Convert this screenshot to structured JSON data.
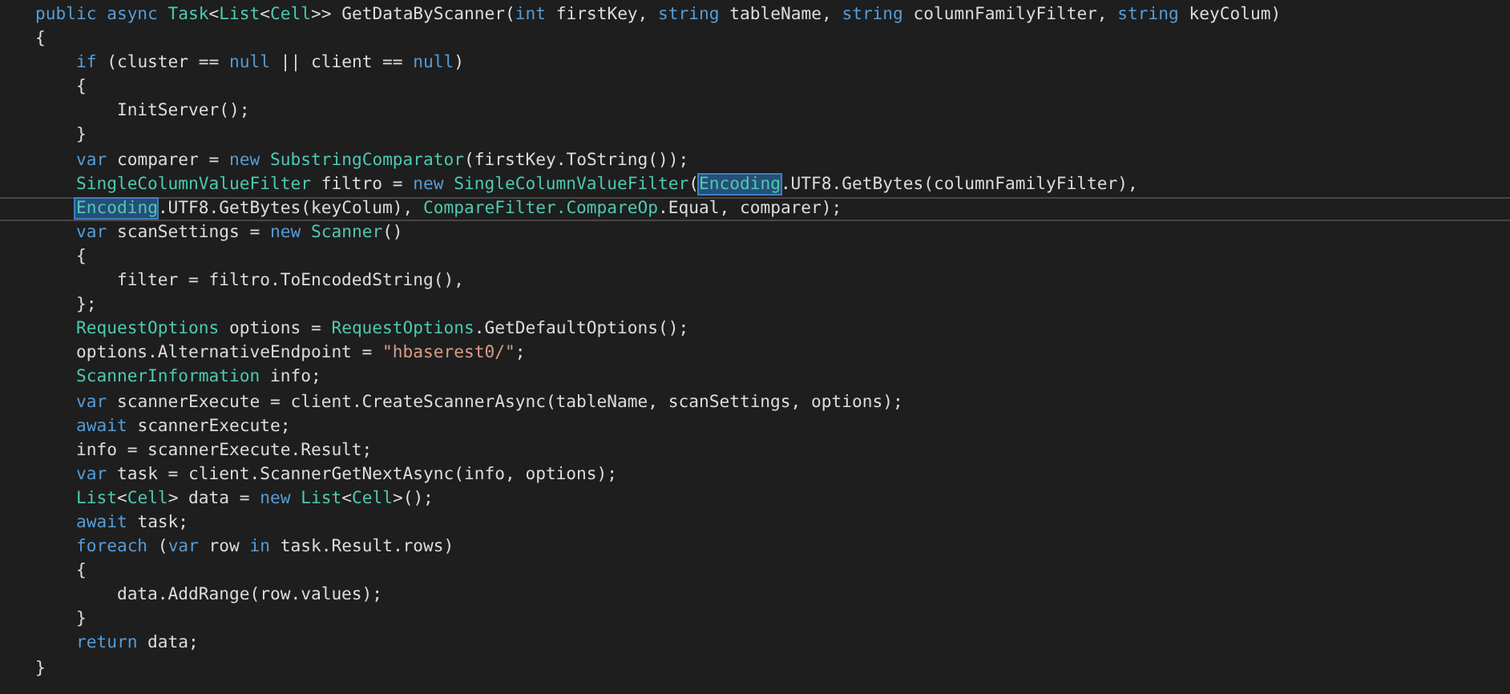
{
  "editor": {
    "lines": [
      {
        "current": false,
        "tokens": [
          {
            "kind": "keyword",
            "text": "public async"
          },
          {
            "kind": "type",
            "text": " Task"
          },
          {
            "kind": "text",
            "text": "<"
          },
          {
            "kind": "type",
            "text": "List"
          },
          {
            "kind": "text",
            "text": "<"
          },
          {
            "kind": "type",
            "text": "Cell"
          },
          {
            "kind": "text",
            "text": ">> GetDataByScanner("
          },
          {
            "kind": "keyword",
            "text": "int"
          },
          {
            "kind": "text",
            "text": " firstKey, "
          },
          {
            "kind": "keyword",
            "text": "string"
          },
          {
            "kind": "text",
            "text": " tableName, "
          },
          {
            "kind": "keyword",
            "text": "string"
          },
          {
            "kind": "text",
            "text": " columnFamilyFilter, "
          },
          {
            "kind": "keyword",
            "text": "string"
          },
          {
            "kind": "text",
            "text": " keyColum)"
          }
        ]
      },
      {
        "current": false,
        "tokens": [
          {
            "kind": "text",
            "text": "{"
          }
        ]
      },
      {
        "current": false,
        "tokens": [
          {
            "kind": "keyword",
            "text": "    if"
          },
          {
            "kind": "text",
            "text": " (cluster == "
          },
          {
            "kind": "keyword",
            "text": "null"
          },
          {
            "kind": "text",
            "text": " || client == "
          },
          {
            "kind": "keyword",
            "text": "null"
          },
          {
            "kind": "text",
            "text": ")"
          }
        ]
      },
      {
        "current": false,
        "tokens": [
          {
            "kind": "text",
            "text": "    {"
          }
        ]
      },
      {
        "current": false,
        "tokens": [
          {
            "kind": "text",
            "text": "        InitServer();"
          }
        ]
      },
      {
        "current": false,
        "tokens": [
          {
            "kind": "text",
            "text": "    }"
          }
        ]
      },
      {
        "current": false,
        "tokens": [
          {
            "kind": "keyword",
            "text": "    var"
          },
          {
            "kind": "text",
            "text": " comparer = "
          },
          {
            "kind": "keyword",
            "text": "new"
          },
          {
            "kind": "type",
            "text": " SubstringComparator"
          },
          {
            "kind": "text",
            "text": "(firstKey.ToString());"
          }
        ]
      },
      {
        "current": false,
        "tokens": [
          {
            "kind": "type",
            "text": "    SingleColumnValueFilter"
          },
          {
            "kind": "text",
            "text": " filtro = "
          },
          {
            "kind": "keyword",
            "text": "new"
          },
          {
            "kind": "type",
            "text": " SingleColumnValueFilter"
          },
          {
            "kind": "text",
            "text": "("
          },
          {
            "kind": "match",
            "text": "Encoding"
          },
          {
            "kind": "text",
            "text": ".UTF8.GetBytes(columnFamilyFilter),"
          }
        ]
      },
      {
        "current": true,
        "tokens": [
          {
            "kind": "match",
            "text": "    Encoding"
          },
          {
            "kind": "text",
            "text": ".UTF8.GetBytes(keyColum), "
          },
          {
            "kind": "type",
            "text": "CompareFilter.CompareOp"
          },
          {
            "kind": "text",
            "text": ".Equal, comparer);"
          }
        ]
      },
      {
        "current": false,
        "tokens": [
          {
            "kind": "keyword",
            "text": "    var"
          },
          {
            "kind": "text",
            "text": " scanSettings = "
          },
          {
            "kind": "keyword",
            "text": "new"
          },
          {
            "kind": "type",
            "text": " Scanner"
          },
          {
            "kind": "text",
            "text": "()"
          }
        ]
      },
      {
        "current": false,
        "tokens": [
          {
            "kind": "text",
            "text": "    {"
          }
        ]
      },
      {
        "current": false,
        "tokens": [
          {
            "kind": "text",
            "text": "        filter = filtro.ToEncodedString(),"
          }
        ]
      },
      {
        "current": false,
        "tokens": [
          {
            "kind": "text",
            "text": "    };"
          }
        ]
      },
      {
        "current": false,
        "tokens": [
          {
            "kind": "type",
            "text": "    RequestOptions"
          },
          {
            "kind": "text",
            "text": " options = "
          },
          {
            "kind": "type",
            "text": "RequestOptions"
          },
          {
            "kind": "text",
            "text": ".GetDefaultOptions();"
          }
        ]
      },
      {
        "current": false,
        "tokens": [
          {
            "kind": "text",
            "text": "    options.AlternativeEndpoint = "
          },
          {
            "kind": "string",
            "text": "\"hbaserest0/\""
          },
          {
            "kind": "text",
            "text": ";"
          }
        ]
      },
      {
        "current": false,
        "tokens": [
          {
            "kind": "type",
            "text": "    ScannerInformation"
          },
          {
            "kind": "text",
            "text": " info;"
          }
        ]
      },
      {
        "current": false,
        "tokens": [
          {
            "kind": "keyword",
            "text": "    var"
          },
          {
            "kind": "text",
            "text": " scannerExecute = client.CreateScannerAsync(tableName, scanSettings, options);"
          }
        ]
      },
      {
        "current": false,
        "tokens": [
          {
            "kind": "keyword",
            "text": "    await"
          },
          {
            "kind": "text",
            "text": " scannerExecute;"
          }
        ]
      },
      {
        "current": false,
        "tokens": [
          {
            "kind": "text",
            "text": "    info = scannerExecute.Result;"
          }
        ]
      },
      {
        "current": false,
        "tokens": [
          {
            "kind": "keyword",
            "text": "    var"
          },
          {
            "kind": "text",
            "text": " task = client.ScannerGetNextAsync(info, options);"
          }
        ]
      },
      {
        "current": false,
        "tokens": [
          {
            "kind": "type",
            "text": "    List"
          },
          {
            "kind": "text",
            "text": "<"
          },
          {
            "kind": "type",
            "text": "Cell"
          },
          {
            "kind": "text",
            "text": "> data = "
          },
          {
            "kind": "keyword",
            "text": "new"
          },
          {
            "kind": "type",
            "text": " List"
          },
          {
            "kind": "text",
            "text": "<"
          },
          {
            "kind": "type",
            "text": "Cell"
          },
          {
            "kind": "text",
            "text": ">();"
          }
        ]
      },
      {
        "current": false,
        "tokens": [
          {
            "kind": "keyword",
            "text": "    await"
          },
          {
            "kind": "text",
            "text": " task;"
          }
        ]
      },
      {
        "current": false,
        "tokens": [
          {
            "kind": "keyword",
            "text": "    foreach"
          },
          {
            "kind": "text",
            "text": " ("
          },
          {
            "kind": "keyword",
            "text": "var"
          },
          {
            "kind": "text",
            "text": " row "
          },
          {
            "kind": "keyword",
            "text": "in"
          },
          {
            "kind": "text",
            "text": " task.Result.rows)"
          }
        ]
      },
      {
        "current": false,
        "tokens": [
          {
            "kind": "text",
            "text": "    {"
          }
        ]
      },
      {
        "current": false,
        "tokens": [
          {
            "kind": "text",
            "text": "        data.AddRange(row.values);"
          }
        ]
      },
      {
        "current": false,
        "tokens": [
          {
            "kind": "text",
            "text": "    }"
          }
        ]
      },
      {
        "current": false,
        "tokens": [
          {
            "kind": "keyword",
            "text": "    return"
          },
          {
            "kind": "text",
            "text": " data;"
          }
        ]
      },
      {
        "current": false,
        "tokens": [
          {
            "kind": "text",
            "text": "}"
          }
        ]
      }
    ]
  }
}
